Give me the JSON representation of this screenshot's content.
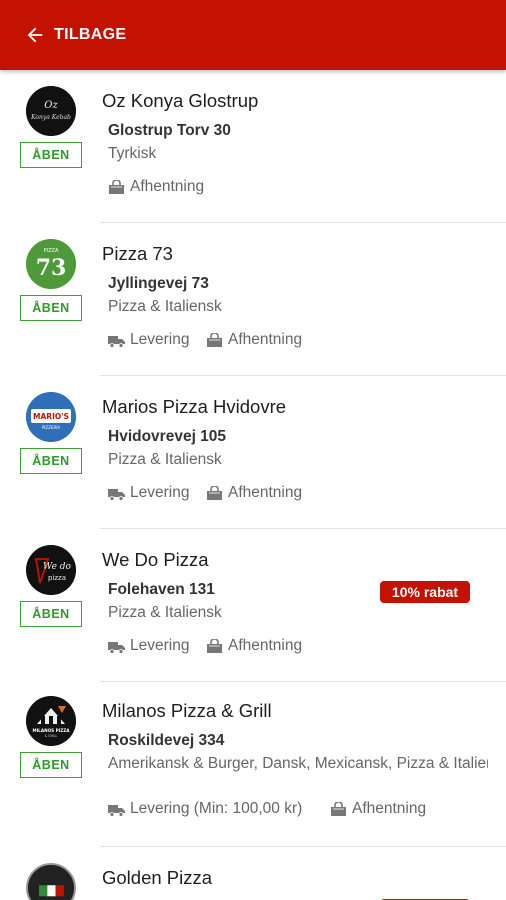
{
  "header": {
    "back_label": "TILBAGE",
    "accent_color": "#c41200",
    "back_icon": "arrow-left-icon"
  },
  "restaurants": [
    {
      "name": "Oz Konya Glostrup",
      "status": "ÅBEN",
      "address": "Glostrup Torv 30",
      "cuisine": "Tyrkisk",
      "services": [
        {
          "icon": "bag-icon",
          "label": "Afhentning"
        }
      ],
      "logo_text": "Oz Konya Kebab"
    },
    {
      "name": "Pizza 73",
      "status": "ÅBEN",
      "address": "Jyllingevej 73",
      "cuisine": "Pizza & Italiensk",
      "services": [
        {
          "icon": "truck-icon",
          "label": "Levering"
        },
        {
          "icon": "bag-icon",
          "label": "Afhentning"
        }
      ],
      "logo_text": "PIZZA 73"
    },
    {
      "name": "Marios Pizza Hvidovre",
      "status": "ÅBEN",
      "address": "Hvidovrevej 105",
      "cuisine": "Pizza & Italiensk",
      "services": [
        {
          "icon": "truck-icon",
          "label": "Levering"
        },
        {
          "icon": "bag-icon",
          "label": "Afhentning"
        }
      ],
      "logo_text": "MARIO'S PIZZERIA"
    },
    {
      "name": "We Do Pizza",
      "status": "ÅBEN",
      "address": "Folehaven 131",
      "cuisine": "Pizza & Italiensk",
      "discount": "10% rabat",
      "services": [
        {
          "icon": "truck-icon",
          "label": "Levering"
        },
        {
          "icon": "bag-icon",
          "label": "Afhentning"
        }
      ],
      "logo_text": "We do pizza"
    },
    {
      "name": "Milanos Pizza & Grill",
      "status": "ÅBEN",
      "address": "Roskildevej 334",
      "cuisine": "Amerikansk & Burger, Dansk, Mexicansk, Pizza & Italiensk",
      "services": [
        {
          "icon": "truck-icon",
          "label": "Levering (Min: 100,00 kr)"
        },
        {
          "icon": "bag-icon",
          "label": "Afhentning"
        }
      ],
      "logo_text": "MILANOS PIZZA"
    },
    {
      "name": "Golden Pizza"
    }
  ]
}
